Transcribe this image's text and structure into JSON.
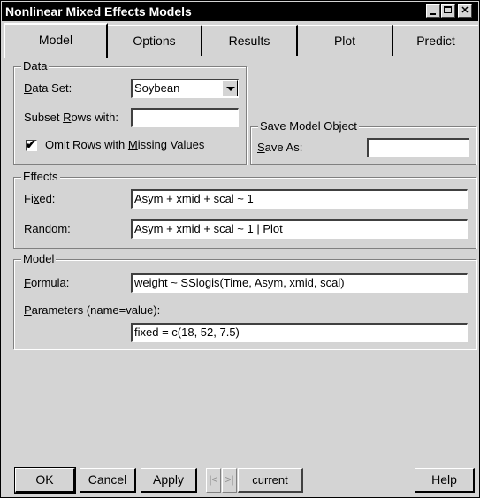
{
  "window": {
    "title": "Nonlinear Mixed Effects Models",
    "minimize_icon": "minimize-icon",
    "maximize_icon": "maximize-icon",
    "close_icon": "close-icon"
  },
  "tabs": [
    {
      "label": "Model",
      "active": true
    },
    {
      "label": "Options",
      "active": false
    },
    {
      "label": "Results",
      "active": false
    },
    {
      "label": "Plot",
      "active": false
    },
    {
      "label": "Predict",
      "active": false
    }
  ],
  "data_group": {
    "title": "Data",
    "data_set_label_pre": "",
    "data_set_label_u": "D",
    "data_set_label_post": "ata Set:",
    "data_set_value": "Soybean",
    "subset_label_pre": "Subset ",
    "subset_label_u": "R",
    "subset_label_post": "ows with:",
    "subset_value": "",
    "omit_label_pre": "Omit Rows with ",
    "omit_label_u": "M",
    "omit_label_post": "issing Values",
    "omit_checked": true,
    "check_glyph": "✔"
  },
  "save_group": {
    "title": "Save Model Object",
    "save_as_label_pre": "",
    "save_as_label_u": "S",
    "save_as_label_post": "ave As:",
    "save_as_value": ""
  },
  "effects_group": {
    "title": "Effects",
    "fixed_label_pre": "Fi",
    "fixed_label_u": "x",
    "fixed_label_post": "ed:",
    "fixed_value": "Asym +  xmid + scal ~ 1",
    "random_label_pre": "Ra",
    "random_label_u": "n",
    "random_label_post": "dom:",
    "random_value": "Asym + xmid + scal ~ 1 | Plot"
  },
  "model_group": {
    "title": "Model",
    "formula_label_pre": "",
    "formula_label_u": "F",
    "formula_label_post": "ormula:",
    "formula_value": "weight ~ SSlogis(Time, Asym, xmid, scal)",
    "params_label_pre": "",
    "params_label_u": "P",
    "params_label_post": "arameters (name=value):",
    "params_value": "fixed = c(18, 52, 7.5)"
  },
  "buttons": {
    "ok": "OK",
    "cancel": "Cancel",
    "apply": "Apply",
    "prev": "|<",
    "next": ">|",
    "current": "current",
    "help": "Help"
  }
}
